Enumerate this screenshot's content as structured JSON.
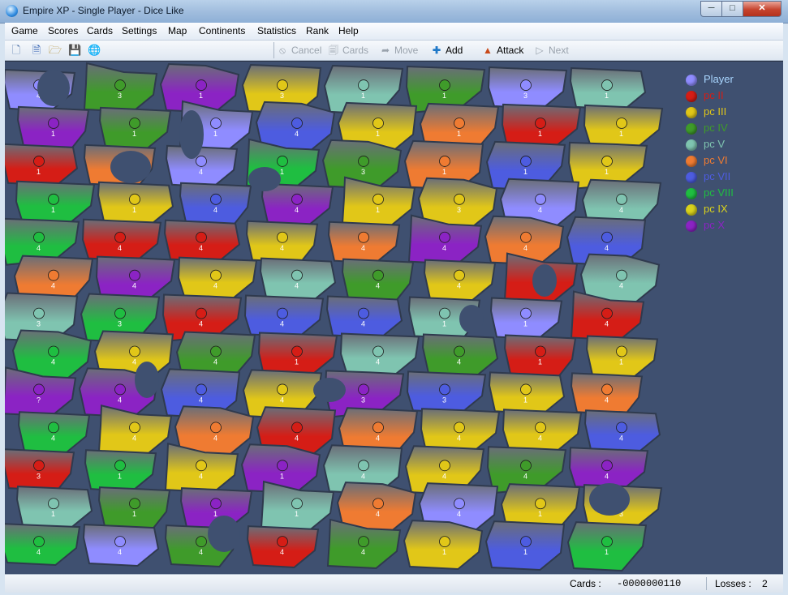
{
  "window": {
    "title": "Empire XP - Single Player - Dice Like"
  },
  "menu": [
    "Game",
    "Scores",
    "Cards",
    "Settings",
    "Map",
    "Continents",
    "Statistics",
    "Rank",
    "Help"
  ],
  "toolbar": {
    "icons": [
      "new-game-icon",
      "document-icon",
      "open-folder-icon",
      "save-icon",
      "globe-icon"
    ],
    "cancel": "Cancel",
    "cards": "Cards",
    "move": "Move",
    "add": "Add",
    "attack": "Attack",
    "next": "Next"
  },
  "legend": [
    {
      "name": "Player",
      "color": "#8f8cff"
    },
    {
      "name": "pc II",
      "color": "#d51d16"
    },
    {
      "name": "pc III",
      "color": "#e1c718"
    },
    {
      "name": "pc IV",
      "color": "#3f9b2a"
    },
    {
      "name": "pc V",
      "color": "#7fc4b0"
    },
    {
      "name": "pc VI",
      "color": "#ef7b32"
    },
    {
      "name": "pc VII",
      "color": "#4d5ce0"
    },
    {
      "name": "pc VIII",
      "color": "#1fbe41"
    },
    {
      "name": "pc IX",
      "color": "#d9d21c"
    },
    {
      "name": "pc X",
      "color": "#8b23c4"
    }
  ],
  "territories": [
    {
      "owner": 1,
      "army": "4"
    },
    {
      "owner": 4,
      "army": "3"
    },
    {
      "owner": 10,
      "army": "1"
    },
    {
      "owner": 3,
      "army": "3"
    },
    {
      "owner": 5,
      "army": "1"
    },
    {
      "owner": 4,
      "army": "1"
    },
    {
      "owner": 1,
      "army": "3"
    },
    {
      "owner": 5,
      "army": "1"
    },
    {
      "owner": 10,
      "army": "1"
    },
    {
      "owner": 4,
      "army": "1"
    },
    {
      "owner": 1,
      "army": "1"
    },
    {
      "owner": 7,
      "army": "4"
    },
    {
      "owner": 3,
      "army": "1"
    },
    {
      "owner": 6,
      "army": "1"
    },
    {
      "owner": 2,
      "army": "1"
    },
    {
      "owner": 3,
      "army": "1"
    },
    {
      "owner": 2,
      "army": "1"
    },
    {
      "owner": 6,
      "army": "3"
    },
    {
      "owner": 1,
      "army": "4"
    },
    {
      "owner": 8,
      "army": "1"
    },
    {
      "owner": 4,
      "army": "3"
    },
    {
      "owner": 6,
      "army": "1"
    },
    {
      "owner": 7,
      "army": "1"
    },
    {
      "owner": 3,
      "army": "1"
    },
    {
      "owner": 8,
      "army": "1"
    },
    {
      "owner": 3,
      "army": "1"
    },
    {
      "owner": 7,
      "army": "4"
    },
    {
      "owner": 10,
      "army": "4"
    },
    {
      "owner": 3,
      "army": "1"
    },
    {
      "owner": 3,
      "army": "3"
    },
    {
      "owner": 1,
      "army": "4"
    },
    {
      "owner": 5,
      "army": "4"
    },
    {
      "owner": 8,
      "army": "4"
    },
    {
      "owner": 2,
      "army": "4"
    },
    {
      "owner": 2,
      "army": "4"
    },
    {
      "owner": 3,
      "army": "4"
    },
    {
      "owner": 6,
      "army": "4"
    },
    {
      "owner": 10,
      "army": "4"
    },
    {
      "owner": 6,
      "army": "4"
    },
    {
      "owner": 7,
      "army": "4"
    },
    {
      "owner": 6,
      "army": "4"
    },
    {
      "owner": 10,
      "army": "4"
    },
    {
      "owner": 3,
      "army": "4"
    },
    {
      "owner": 5,
      "army": "4"
    },
    {
      "owner": 4,
      "army": "4"
    },
    {
      "owner": 3,
      "army": "4"
    },
    {
      "owner": 2,
      "army": "1"
    },
    {
      "owner": 5,
      "army": "4"
    },
    {
      "owner": 5,
      "army": "3"
    },
    {
      "owner": 8,
      "army": "3"
    },
    {
      "owner": 2,
      "army": "4"
    },
    {
      "owner": 7,
      "army": "4"
    },
    {
      "owner": 7,
      "army": "4"
    },
    {
      "owner": 5,
      "army": "1"
    },
    {
      "owner": 1,
      "army": "1"
    },
    {
      "owner": 2,
      "army": "4"
    },
    {
      "owner": 8,
      "army": "4"
    },
    {
      "owner": 3,
      "army": "4"
    },
    {
      "owner": 4,
      "army": "4"
    },
    {
      "owner": 2,
      "army": "1"
    },
    {
      "owner": 5,
      "army": "4"
    },
    {
      "owner": 4,
      "army": "4"
    },
    {
      "owner": 2,
      "army": "1"
    },
    {
      "owner": 3,
      "army": "1"
    },
    {
      "owner": 10,
      "army": "?"
    },
    {
      "owner": 10,
      "army": "4"
    },
    {
      "owner": 7,
      "army": "4"
    },
    {
      "owner": 3,
      "army": "4"
    },
    {
      "owner": 10,
      "army": "3"
    },
    {
      "owner": 7,
      "army": "3"
    },
    {
      "owner": 3,
      "army": "1"
    },
    {
      "owner": 6,
      "army": "4"
    },
    {
      "owner": 8,
      "army": "4"
    },
    {
      "owner": 3,
      "army": "4"
    },
    {
      "owner": 6,
      "army": "4"
    },
    {
      "owner": 2,
      "army": "4"
    },
    {
      "owner": 6,
      "army": "4"
    },
    {
      "owner": 3,
      "army": "4"
    },
    {
      "owner": 3,
      "army": "4"
    },
    {
      "owner": 7,
      "army": "4"
    },
    {
      "owner": 2,
      "army": "3"
    },
    {
      "owner": 8,
      "army": "1"
    },
    {
      "owner": 3,
      "army": "4"
    },
    {
      "owner": 10,
      "army": "1"
    },
    {
      "owner": 5,
      "army": "4"
    },
    {
      "owner": 3,
      "army": "4"
    },
    {
      "owner": 4,
      "army": "4"
    },
    {
      "owner": 10,
      "army": "4"
    },
    {
      "owner": 5,
      "army": "1"
    },
    {
      "owner": 4,
      "army": "1"
    },
    {
      "owner": 10,
      "army": "1"
    },
    {
      "owner": 5,
      "army": "1"
    },
    {
      "owner": 6,
      "army": "4"
    },
    {
      "owner": 1,
      "army": "4"
    },
    {
      "owner": 3,
      "army": "1"
    },
    {
      "owner": 3,
      "army": "3"
    },
    {
      "owner": 8,
      "army": "4"
    },
    {
      "owner": 1,
      "army": "4"
    },
    {
      "owner": 4,
      "army": "4"
    },
    {
      "owner": 2,
      "army": "4"
    },
    {
      "owner": 4,
      "army": "4"
    },
    {
      "owner": 3,
      "army": "1"
    },
    {
      "owner": 7,
      "army": "1"
    },
    {
      "owner": 8,
      "army": "1"
    }
  ],
  "status": {
    "cards_label": "Cards :",
    "cards_value": "-0000000110",
    "losses_label": "Losses :",
    "losses_value": "2"
  }
}
